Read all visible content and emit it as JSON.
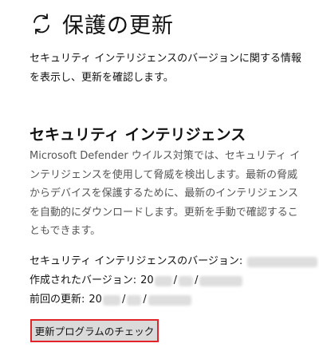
{
  "header": {
    "title": "保護の更新",
    "icon": "refresh-icon"
  },
  "description": "セキュリティ インテリジェンスのバージョンに関する情報を表示し、更新を確認します。",
  "section": {
    "heading": "セキュリティ インテリジェンス",
    "body": "Microsoft Defender ウイルス対策では、セキュリティ インテリジェンスを使用して脅威を検出します。最新の脅威からデバイスを保護するために、最新のインテリジェンスを自動的にダウンロードします。更新を手動で確認することもできます。"
  },
  "info": {
    "version_label": "セキュリティ インテリジェンスのバージョン:",
    "created_label": "作成されたバージョン:",
    "created_year_prefix": "20",
    "last_update_label": "前回の更新:",
    "last_update_year_prefix": "20",
    "date_separator": "/"
  },
  "button": {
    "check_label": "更新プログラムのチェック",
    "highlight_color": "#e0242a"
  }
}
